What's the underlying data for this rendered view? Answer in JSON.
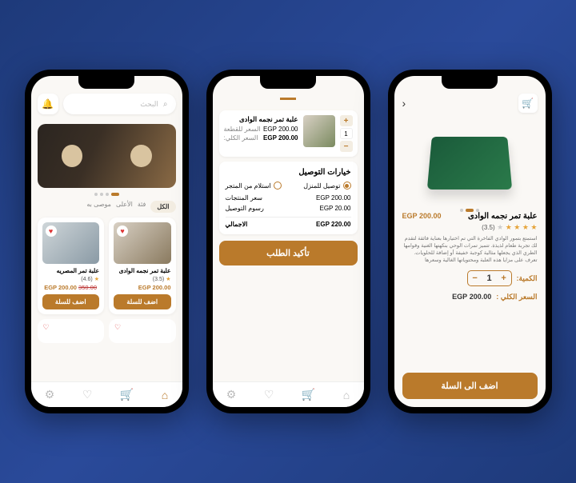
{
  "screen1": {
    "search_placeholder": "البحث",
    "tabs": [
      "الكل",
      "فئة",
      "الأعلى",
      "موصى به"
    ],
    "products": [
      {
        "title": "علبة تمر نجمه الوادى",
        "rating": "(3.5)",
        "price": "EGP 200.00",
        "button": "اضف للسلة"
      },
      {
        "title": "علبة تمر المصريه",
        "rating": "(4.6)",
        "price": "EGP 200.00",
        "old_price": "350.00",
        "button": "اضف للسلة"
      }
    ]
  },
  "screen2": {
    "cart_item": {
      "title": "علبة تمر نجمه الوادى",
      "unit_label": "السعر للقطعة",
      "unit_value": "EGP 200.00",
      "total_label": "السعر الكلي:",
      "total_value": "EGP 200.00",
      "qty": "1"
    },
    "delivery": {
      "title": "خيارات التوصيل",
      "opt_home": "توصيل للمنزل",
      "opt_store": "استلام من المتجر",
      "subtotal_label": "سعر المنتجات",
      "subtotal_value": "EGP 200.00",
      "shipping_label": "رسوم التوصيل",
      "shipping_value": "EGP 20.00",
      "total_label": "الاجمالي",
      "total_value": "EGP 220.00"
    },
    "confirm": "تأكيد الطلب"
  },
  "screen3": {
    "title": "علبة تمر نجمه الوادى",
    "price": "200.00 EGP",
    "rating": "(3.5)",
    "description": "استمتع بتمور الوادي الفاخرة التي تم اختيارها بعناية فائقة لتقدم لك تجربة طعام لذيذة. تتميز تمرات الوحي بنكهتها الغنية وقوامها الطري الذي يجعلها مثالية كوجبة خفيفة أو إضافة للحلويات. تعرف على مزايا هذه العلبة ومحتوياتها الغالية وسعرها",
    "qty_label": "الكمية:",
    "qty": "1",
    "total_label": "السعر الكلي :",
    "total_value": "200.00 EGP",
    "button": "اضف الى السلة"
  }
}
